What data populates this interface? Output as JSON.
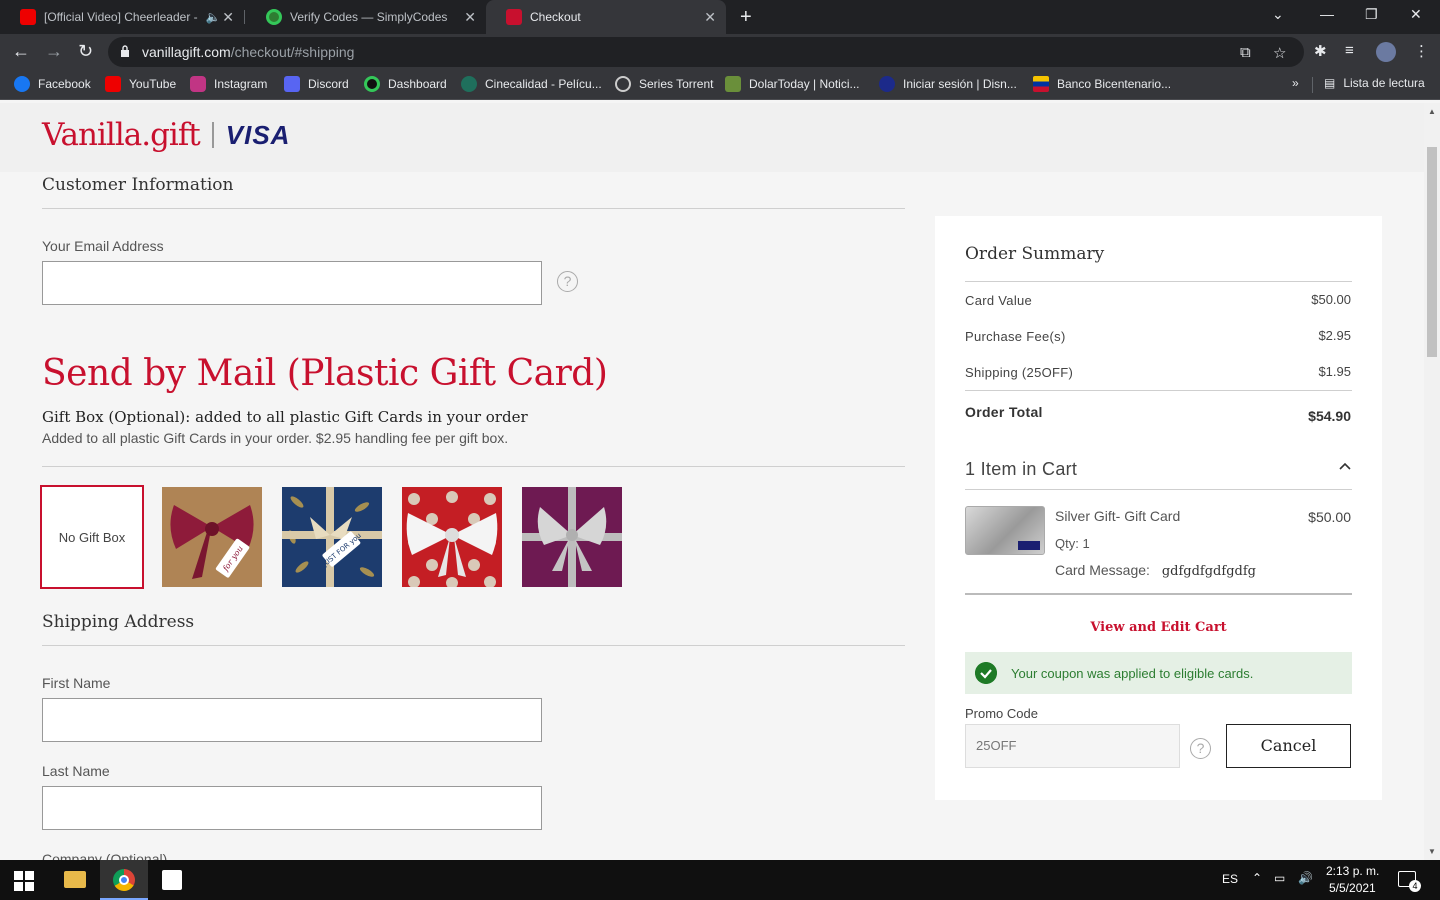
{
  "browser": {
    "tabs": [
      {
        "label": "[Official Video] Cheerleader -"
      },
      {
        "label": "Verify Codes — SimplyCodes"
      },
      {
        "label": "Checkout"
      }
    ],
    "url_host": "vanillagift.com",
    "url_path": "/checkout/#shipping",
    "bookmarks": [
      "Facebook",
      "YouTube",
      "Instagram",
      "Discord",
      "Dashboard",
      "Cinecalidad - Pelícu...",
      "Series Torrent",
      "DolarToday | Notici...",
      "Iniciar sesión | Disn...",
      "Banco Bicentenario..."
    ],
    "reading_list": "Lista de lectura",
    "more": "»"
  },
  "brand": {
    "vanilla": "Vanilla.gift",
    "visa": "VISA"
  },
  "customer": {
    "title": "Customer Information",
    "email_label": "Your Email Address",
    "email_value": "",
    "help": "?"
  },
  "mail": {
    "title": "Send by Mail (Plastic Gift Card)",
    "giftbox_title": "Gift Box (Optional): added to all plastic Gift Cards in your order",
    "giftbox_sub": "Added to all plastic Gift Cards in your order. $2.95 handling fee per gift box.",
    "no_gift_box": "No Gift Box",
    "box2_text": "for you",
    "box3_text": "JUST FOR you"
  },
  "shipping": {
    "title": "Shipping Address",
    "first_name_label": "First Name",
    "last_name_label": "Last Name",
    "company_label": "Company (Optional)"
  },
  "summary": {
    "title": "Order Summary",
    "rows": [
      {
        "label": "Card Value",
        "value": "$50.00"
      },
      {
        "label": "Purchase Fee(s)",
        "value": "$2.95"
      },
      {
        "label": "Shipping (25OFF)",
        "value": "$1.95"
      }
    ],
    "total_label": "Order Total",
    "total_value": "$54.90",
    "items_title": "1 Item in Cart",
    "item_name": "Silver Gift- Gift Card",
    "item_price": "$50.00",
    "item_qty": "Qty: 1",
    "item_msg_label": "Card Message:",
    "item_msg_value": "gdfgdfgdfgdfg",
    "view_edit": "View and Edit Cart",
    "coupon_msg": "Your coupon was applied to eligible cards.",
    "promo_label": "Promo Code",
    "promo_value": "25OFF",
    "cancel": "Cancel"
  },
  "taskbar": {
    "lang": "ES",
    "time": "2:13 p. m.",
    "date": "5/5/2021",
    "notif": "4"
  },
  "colors": {
    "brand_red": "#c8102e",
    "visa_blue": "#1a1f71",
    "success_green": "#1e7a26"
  }
}
